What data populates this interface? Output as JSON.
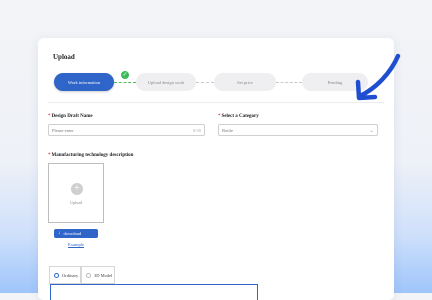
{
  "page": {
    "title": "Upload"
  },
  "steps": [
    {
      "label": "Work information",
      "state": "active"
    },
    {
      "label": "Upload design work",
      "state": "pending"
    },
    {
      "label": "Set price",
      "state": "pending"
    },
    {
      "label": "Pending",
      "state": "pending"
    }
  ],
  "form": {
    "draft_name": {
      "label": "Design Draft Name",
      "placeholder": "Please enter",
      "counter": "0/30"
    },
    "category": {
      "label": "Select a Category",
      "value": "Bottle"
    },
    "tech_description": {
      "label": "Manufacturing technology description"
    },
    "upload": {
      "label": "Upload"
    },
    "download_button": "download",
    "example_link": "Example",
    "tabs": [
      {
        "label": "Ordinary",
        "selected": true
      },
      {
        "label": "3D Model",
        "selected": false
      }
    ]
  },
  "icons": {
    "check": "check-icon",
    "plus": "plus-icon",
    "download": "download-icon",
    "chevron": "chevron-down-icon",
    "arrow": "pointer-arrow-icon"
  },
  "colors": {
    "accent": "#2f64c8",
    "success": "#3db85a",
    "annotation": "#1f4fd0",
    "required": "#e53935"
  }
}
